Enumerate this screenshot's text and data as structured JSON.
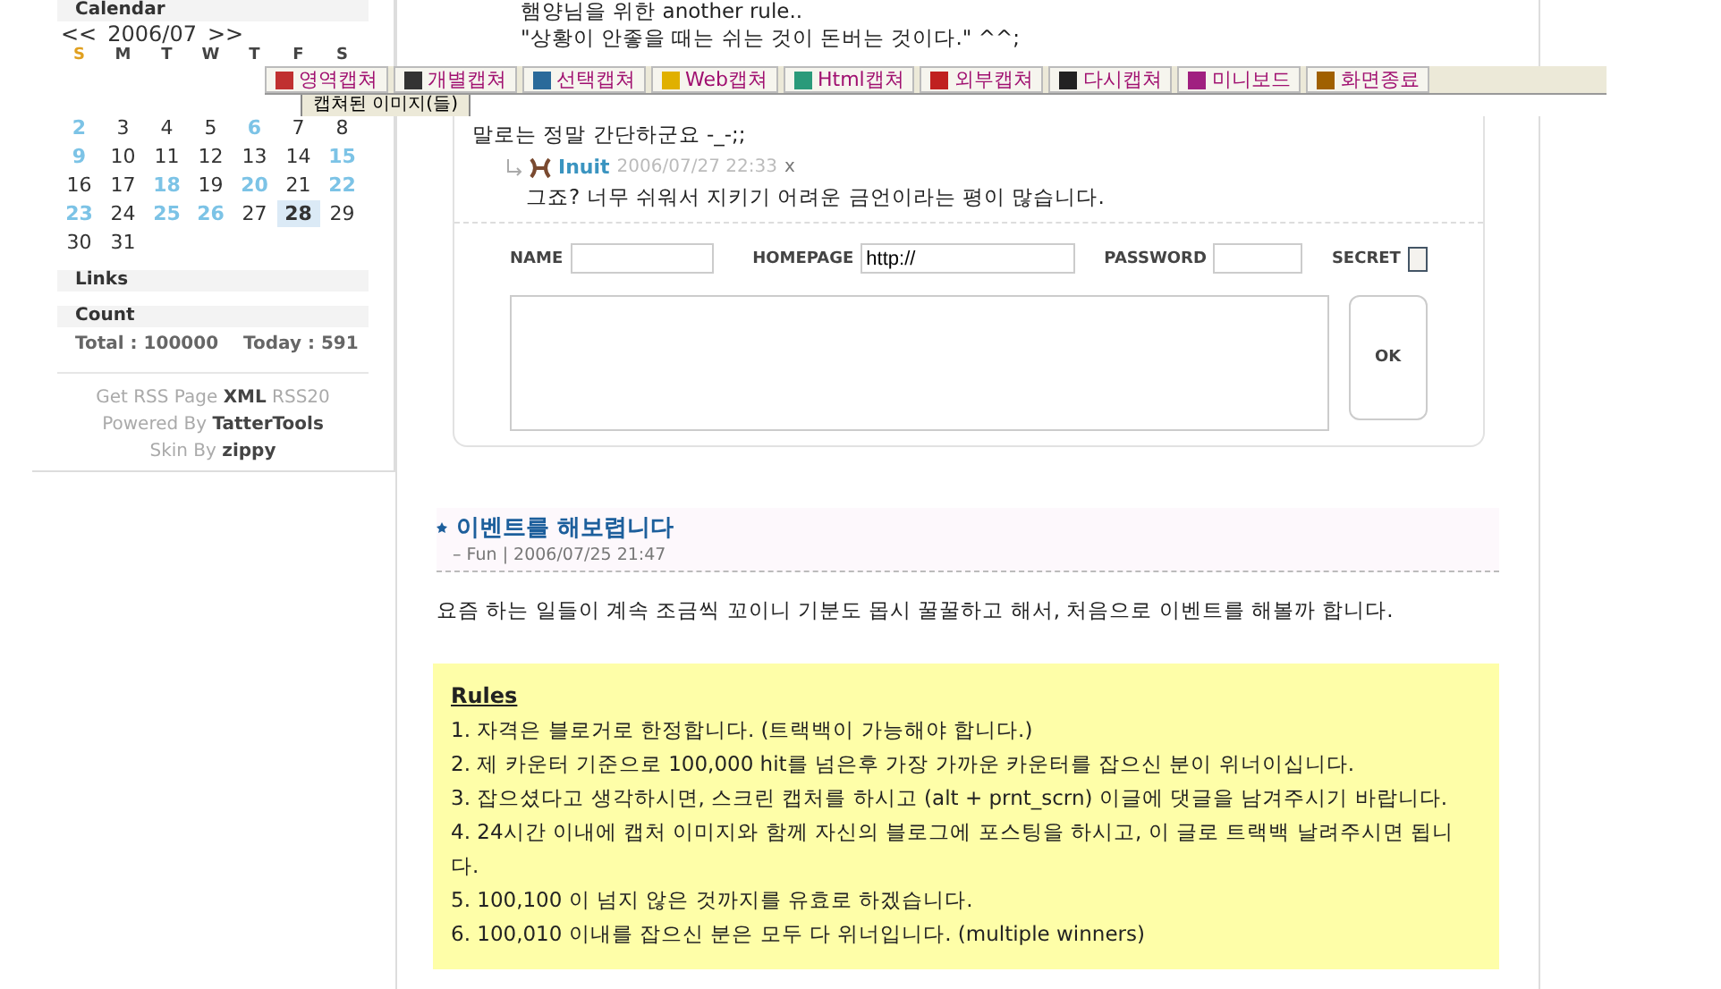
{
  "sidebar": {
    "calendar": {
      "title": "Calendar",
      "prev": "<<",
      "month": "2006/07",
      "next": ">>",
      "weekdays": [
        {
          "label": "S",
          "sunday": true
        },
        {
          "label": "M",
          "sunday": false
        },
        {
          "label": "T",
          "sunday": false
        },
        {
          "label": "W",
          "sunday": false
        },
        {
          "label": "T",
          "sunday": false
        },
        {
          "label": "F",
          "sunday": false
        },
        {
          "label": "S",
          "sunday": false
        }
      ],
      "weeks": [
        [
          {
            "day": "2",
            "linked": true,
            "selected": false
          },
          {
            "day": "3",
            "linked": false,
            "selected": false
          },
          {
            "day": "4",
            "linked": false,
            "selected": false
          },
          {
            "day": "5",
            "linked": false,
            "selected": false
          },
          {
            "day": "6",
            "linked": true,
            "selected": false
          },
          {
            "day": "7",
            "linked": false,
            "selected": false
          },
          {
            "day": "8",
            "linked": false,
            "selected": false
          }
        ],
        [
          {
            "day": "9",
            "linked": true,
            "selected": false
          },
          {
            "day": "10",
            "linked": false,
            "selected": false
          },
          {
            "day": "11",
            "linked": false,
            "selected": false
          },
          {
            "day": "12",
            "linked": false,
            "selected": false
          },
          {
            "day": "13",
            "linked": false,
            "selected": false
          },
          {
            "day": "14",
            "linked": false,
            "selected": false
          },
          {
            "day": "15",
            "linked": true,
            "selected": false
          }
        ],
        [
          {
            "day": "16",
            "linked": false,
            "selected": false
          },
          {
            "day": "17",
            "linked": false,
            "selected": false
          },
          {
            "day": "18",
            "linked": true,
            "selected": false
          },
          {
            "day": "19",
            "linked": false,
            "selected": false
          },
          {
            "day": "20",
            "linked": true,
            "selected": false
          },
          {
            "day": "21",
            "linked": false,
            "selected": false
          },
          {
            "day": "22",
            "linked": true,
            "selected": false
          }
        ],
        [
          {
            "day": "23",
            "linked": true,
            "selected": false
          },
          {
            "day": "24",
            "linked": false,
            "selected": false
          },
          {
            "day": "25",
            "linked": true,
            "selected": false
          },
          {
            "day": "26",
            "linked": true,
            "selected": false
          },
          {
            "day": "27",
            "linked": false,
            "selected": false
          },
          {
            "day": "28",
            "linked": false,
            "selected": true
          },
          {
            "day": "29",
            "linked": false,
            "selected": false
          }
        ],
        [
          {
            "day": "30",
            "linked": false,
            "selected": false
          },
          {
            "day": "31",
            "linked": false,
            "selected": false
          }
        ]
      ]
    },
    "links_title": "Links",
    "count_title": "Count",
    "total": "Total : 100000",
    "today": "Today : 591",
    "footer": [
      [
        "Get RSS Page ",
        "**XML**",
        " RSS20"
      ],
      [
        "Powered By ",
        "**TatterTools**"
      ],
      [
        "Skin By ",
        "**zippy**"
      ]
    ]
  },
  "previous_post": {
    "lines": [
      "햄양님을 위한 another rule..",
      "\"상황이 안좋을 때는 쉬는 것이 돈버는 것이다.\" ^^;"
    ],
    "comment": "말로는 정말 간단하군요 -_-;;",
    "reply": {
      "author": "Inuit",
      "date": "2006/07/27 22:33",
      "delete": "x",
      "text": "그죠? 너무 쉬워서 지키기 어려운 금언이라는 평이 많습니다."
    },
    "form": {
      "name_label": "NAME",
      "homepage_label": "HOMEPAGE",
      "homepage_value": "http://",
      "password_label": "PASSWORD",
      "secret_label": "SECRET",
      "secret_checked": false,
      "submit": "OK"
    }
  },
  "post": {
    "title": "이벤트를 해보렵니다",
    "dash": "–",
    "category": "Fun",
    "separator": "|",
    "date": "2006/07/25 21:47",
    "intro": "요즘 하는 일들이 계속 조금씩 꼬이니 기분도 몹시 꿀꿀하고 해서, 처음으로 이벤트를 해볼까 합니다.",
    "rules_title": "Rules",
    "rules": [
      "1. 자격은 블로거로 한정합니다. (트랙백이 가능해야 합니다.)",
      "2. 제 카운터 기준으로 100,000 hit를 넘은후 가장 가까운 카운터를 잡으신 분이 위너이십니다.",
      "3. 잡으셨다고 생각하시면, 스크린 캡처를 하시고 (alt + prnt_scrn) 이글에 댓글을 남겨주시기 바랍니다.",
      "4. 24시간 이내에 캡처 이미지와 함께 자신의 블로그에 포스팅을 하시고, 이 글로 트랙백 날려주시면 됩니다.",
      "5. 100,100 이 넘지 않은 것까지를 유효로 하겠습니다.",
      "6. 100,010 이내를 잡으신 분은 모두 다 위너입니다. (multiple winners)"
    ]
  },
  "capture_toolbar": {
    "buttons": [
      "영역캡쳐",
      "개별캡쳐",
      "선택캡쳐",
      "Web캡쳐",
      "Html캡쳐",
      "외부캡쳐",
      "다시캡쳐",
      "미니보드",
      "화면종료"
    ],
    "tab": "캡쳐된 이미지(들)"
  }
}
